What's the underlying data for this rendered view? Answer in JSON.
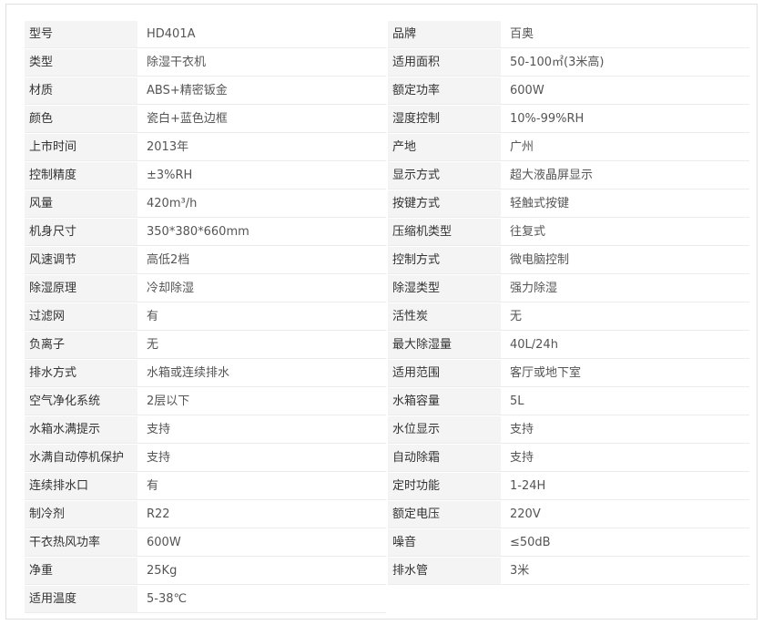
{
  "specs": [
    {
      "label": "型号",
      "value": "HD401A"
    },
    {
      "label": "品牌",
      "value": "百奥"
    },
    {
      "label": "类型",
      "value": "除湿干衣机"
    },
    {
      "label": "适用面积",
      "value": "50-100㎡(3米高)"
    },
    {
      "label": "材质",
      "value": "ABS+精密钣金"
    },
    {
      "label": "额定功率",
      "value": "600W"
    },
    {
      "label": "颜色",
      "value": "瓷白+蓝色边框"
    },
    {
      "label": "湿度控制",
      "value": "10%-99%RH"
    },
    {
      "label": "上市时间",
      "value": "2013年"
    },
    {
      "label": "产地",
      "value": "广州"
    },
    {
      "label": "控制精度",
      "value": "±3%RH"
    },
    {
      "label": "显示方式",
      "value": "超大液晶屏显示"
    },
    {
      "label": "风量",
      "value": "420m³/h"
    },
    {
      "label": "按键方式",
      "value": "轻触式按键"
    },
    {
      "label": "机身尺寸",
      "value": "350*380*660mm"
    },
    {
      "label": "压缩机类型",
      "value": "往复式"
    },
    {
      "label": "风速调节",
      "value": "高低2档"
    },
    {
      "label": "控制方式",
      "value": "微电脑控制"
    },
    {
      "label": "除湿原理",
      "value": "冷却除湿"
    },
    {
      "label": "除湿类型",
      "value": "强力除湿"
    },
    {
      "label": "过滤网",
      "value": "有"
    },
    {
      "label": "活性炭",
      "value": "无"
    },
    {
      "label": "负离子",
      "value": "无"
    },
    {
      "label": "最大除湿量",
      "value": "40L/24h"
    },
    {
      "label": "排水方式",
      "value": "水箱或连续排水"
    },
    {
      "label": "适用范围",
      "value": "客厅或地下室"
    },
    {
      "label": "空气净化系统",
      "value": "2层以下"
    },
    {
      "label": "水箱容量",
      "value": "5L"
    },
    {
      "label": "水箱水满提示",
      "value": "支持"
    },
    {
      "label": "水位显示",
      "value": "支持"
    },
    {
      "label": "水满自动停机保护",
      "value": "支持"
    },
    {
      "label": "自动除霜",
      "value": "支持"
    },
    {
      "label": "连续排水口",
      "value": "有"
    },
    {
      "label": "定时功能",
      "value": "1-24H"
    },
    {
      "label": "制冷剂",
      "value": "R22"
    },
    {
      "label": "额定电压",
      "value": "220V"
    },
    {
      "label": "干衣热风功率",
      "value": "600W"
    },
    {
      "label": "噪音",
      "value": "≤50dB"
    },
    {
      "label": "净重",
      "value": "25Kg"
    },
    {
      "label": "排水管",
      "value": "3米"
    },
    {
      "label": "适用温度",
      "value": "5-38℃"
    }
  ]
}
